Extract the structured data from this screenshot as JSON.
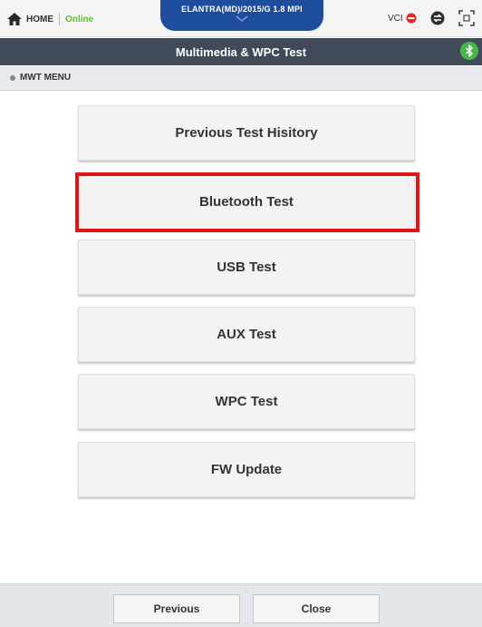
{
  "topbar": {
    "home_label": "HOME",
    "status": "Online",
    "vehicle": "ELANTRA(MD)/2015/G 1.8 MPI",
    "vci_label": "VCI"
  },
  "header": {
    "title": "Multimedia & WPC Test"
  },
  "menu": {
    "label": "MWT MENU"
  },
  "tests": [
    {
      "label": "Previous Test Hisitory"
    },
    {
      "label": "Bluetooth Test"
    },
    {
      "label": "USB Test"
    },
    {
      "label": "AUX Test"
    },
    {
      "label": "WPC Test"
    },
    {
      "label": "FW Update"
    }
  ],
  "footer": {
    "previous_label": "Previous",
    "close_label": "Close"
  },
  "colors": {
    "vehicle_tab": "#1d4d9c",
    "title_bar": "#404a58",
    "online": "#5fbd2b",
    "bluetooth_badge": "#49b64a",
    "highlight": "#e21515"
  },
  "icons": {
    "home": "home-icon",
    "vehicle_expand": "chevron-down-icon",
    "vci_status": "disconnected-icon",
    "swap": "swap-icon",
    "screen": "screen-capture-icon",
    "bluetooth": "bluetooth-icon"
  }
}
